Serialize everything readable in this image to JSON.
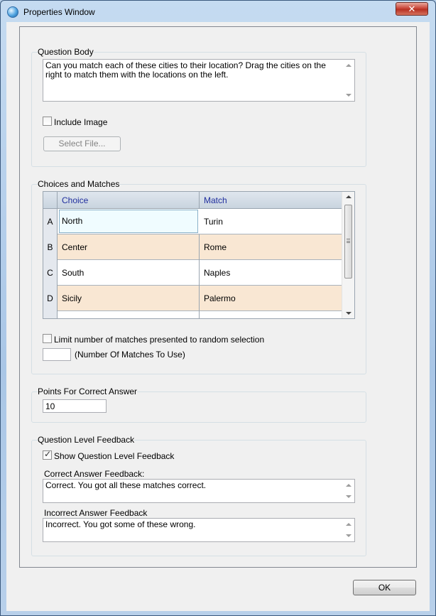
{
  "window": {
    "title": "Properties Window",
    "close_glyph": "✕"
  },
  "question_body": {
    "legend": "Question Body",
    "text": "Can you match each of these cities to their location? Drag the cities on the right to match them with the locations on the left.",
    "include_image_label": "Include Image",
    "include_image_checked": false,
    "select_file_label": "Select File..."
  },
  "choices": {
    "legend": "Choices and Matches",
    "columns": [
      "Choice",
      "Match"
    ],
    "rows": [
      {
        "letter": "A",
        "choice": "North",
        "match": "Turin"
      },
      {
        "letter": "B",
        "choice": "Center",
        "match": "Rome"
      },
      {
        "letter": "C",
        "choice": "South",
        "match": "Naples"
      },
      {
        "letter": "D",
        "choice": "Sicily",
        "match": "Palermo"
      }
    ],
    "limit_label": "Limit number of matches presented to random selection",
    "limit_checked": false,
    "matches_to_use_value": "",
    "matches_to_use_label": "(Number Of Matches To Use)"
  },
  "points": {
    "legend": "Points For Correct Answer",
    "value": "10"
  },
  "feedback": {
    "legend": "Question Level Feedback",
    "show_label": "Show Question Level Feedback",
    "show_checked": true,
    "correct_label": "Correct Answer Feedback:",
    "correct_text": "Correct. You got all these matches correct.",
    "incorrect_label": "Incorrect Answer Feedback",
    "incorrect_text": "Incorrect. You got some of these wrong."
  },
  "footer": {
    "ok_label": "OK"
  }
}
